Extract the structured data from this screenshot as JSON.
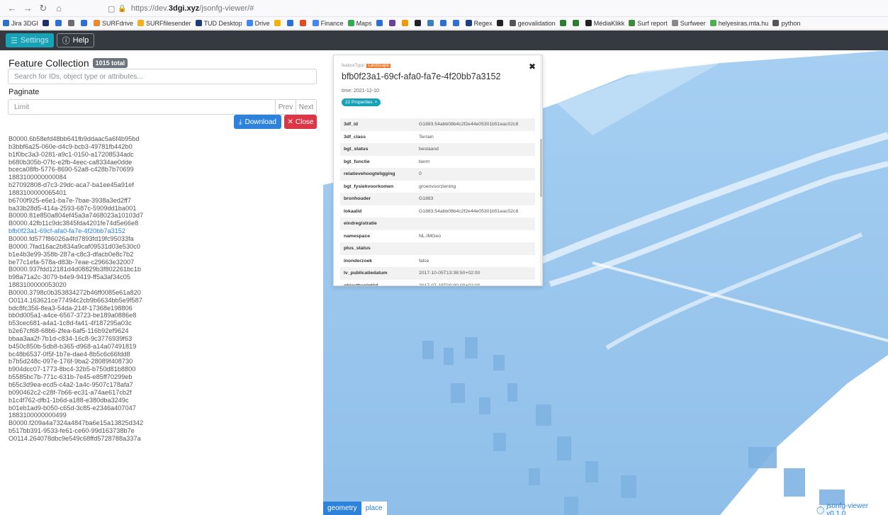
{
  "browser": {
    "url_prefix": "https://dev.",
    "url_domain": "3dgi.xyz",
    "url_path": "/jsonfg-viewer/#",
    "bookmarks": [
      {
        "label": "Jira 3DGI",
        "color": "#2c6fd6"
      },
      {
        "label": "",
        "color": "#1f2f6a"
      },
      {
        "label": "",
        "color": "#2c6fd6"
      },
      {
        "label": "",
        "color": "#6d6d6d"
      },
      {
        "label": "",
        "color": "#2c6fd6"
      },
      {
        "label": "SURFdrive",
        "color": "#f0872b"
      },
      {
        "label": "SURFfilesender",
        "color": "#f2b01e"
      },
      {
        "label": "TUD Desktop",
        "color": "#1c3e78"
      },
      {
        "label": "Drive",
        "color": "#4285f4"
      },
      {
        "label": "",
        "color": "#f5b400"
      },
      {
        "label": "",
        "color": "#2c6fd6"
      },
      {
        "label": "",
        "color": "#e64a19"
      },
      {
        "label": "Finance",
        "color": "#4285f4"
      },
      {
        "label": "Maps",
        "color": "#34a853"
      },
      {
        "label": "",
        "color": "#2c6fd6"
      },
      {
        "label": "",
        "color": "#6b3fa0"
      },
      {
        "label": "",
        "color": "#f29900"
      },
      {
        "label": "",
        "color": "#222222"
      },
      {
        "label": "",
        "color": "#3d7ebf"
      },
      {
        "label": "",
        "color": "#2c6fd6"
      },
      {
        "label": "",
        "color": "#2c6fd6"
      },
      {
        "label": "Regex",
        "color": "#1a3f8a"
      },
      {
        "label": "",
        "color": "#222222"
      },
      {
        "label": "geovalidation",
        "color": "#555555"
      },
      {
        "label": "",
        "color": "#2e7d32"
      },
      {
        "label": "",
        "color": "#2e7d32"
      },
      {
        "label": "MédiaKlikk",
        "color": "#222222"
      },
      {
        "label": "Surf report",
        "color": "#3a8d3a"
      },
      {
        "label": "Surfweer",
        "color": "#888888"
      },
      {
        "label": "helyesiras.mta.hu",
        "color": "#4caf50"
      },
      {
        "label": "python",
        "color": "#555555"
      }
    ]
  },
  "toolbar": {
    "settings_label": "Settings",
    "help_label": "Help"
  },
  "feature_collection": {
    "title": "Feature Collection",
    "total_badge": "1015 total",
    "search_placeholder": "Search for IDs, object type or attributes...",
    "paginate_label": "Paginate",
    "limit_placeholder": "Limit",
    "prev_label": "Prev",
    "next_label": "Next",
    "download_label": "Download",
    "close_label": "Close",
    "selected_id": "bfb0f23a1-69cf-afa0-fa7e-4f20bb7a3152",
    "ids": [
      "B0000.6b58efd48bb641fb9ddaac5a6f4b95bd",
      "b3bbf6a25-060e-d4c9-bcb3-49781fb442b0",
      "b1f0bc3a3-0281-a9c1-0150-a17208534adc",
      "b680b305b-07fc-e2fb-4eec-ca8334ae0dde",
      "bceca08fb-5776-8690-52a8-c428b7b70699",
      "1883100000000084",
      "b27092808-d7c3-29dc-aca7-ba1ee45a91ef",
      "1883100000065401",
      "b6700f925-e6e1-ba7e-7bae-3938a3ed2ff7",
      "ba33b28d5-414a-2593-687c-5909dd1ba001",
      "B0000.81e850a804ef45a3a7468023a10103d7",
      "B0000.42fb11c9dc3845fda4201fe74d5e66e8",
      "bfb0f23a1-69cf-afa0-fa7e-4f20bb7a3152",
      "B0000.fd577f86026a4fd7893fd19fc95033fa",
      "B0000.7fad16ac2b834a9caf09531d03e530c0",
      "b1e4b3e99-358b-287a-c8c3-dfacb0e8c7b2",
      "be77c1efa-578a-d83b-7eae-c29663e32007",
      "B0000.937fdd12181d4d08829b3f802261bc1b",
      "b98a71a2c-3079-b4e9-9419-ff5a3af34c05",
      "1883100000053020",
      "B0000.3798c0b353834272b46ff0085e61a820",
      "O0114.163621ce77494c2cb9b6634bb5e9f587",
      "bdc8fc356-8ea3-54da-214f-17368e198806",
      "bb0d005a1-a4ce-6567-3723-be189a0886e8",
      "b53cec681-a4a1-1c8d-fa41-4f187295a03c",
      "b2e67cf68-68b6-2fea-6af5-116b92ef9624",
      "bbaa3aa2f-7b1d-c834-16c8-9c3776939f63",
      "b450c850b-5db8-b365-d968-a14a07491819",
      "bc48b6537-0f5f-1b7e-dae4-8b5c6c66fdd8",
      "b7b5d248c-097e-176f-9ba2-28089f408730",
      "b904dcc07-1773-8bc4-32b5-b750d81b8800",
      "b5585bc7b-771c-631b-7e45-e85ff70299eb",
      "b65c3d9ea-ecd5-c4a2-1a4c-9507c178afa7",
      "b090462c2-c28f-7b66-ec31-a74ae617cb2f",
      "b1c4f762-dfb1-1b6d-a188-e380dba3249c",
      "b01eb1ad9-b050-c65d-3c85-e2346a407047",
      "1883100000000499",
      "B0000.f209a4a7324a4847ba6e15a13825d342",
      "b517bb391-9533-fe61-ce60-99d163738b7e",
      "O0114.264078dbc9e549c68ffd5728788a337a"
    ]
  },
  "popup": {
    "feature_type_label": "featureType:",
    "feature_type_value": "Landscape",
    "title": "bfb0f23a1-69cf-afa0-fa7e-4f20bb7a3152",
    "time": "time: 2021-12-10",
    "properties_pill": "22 Properties",
    "properties": [
      {
        "key": "3df_id",
        "value": "G1883.54abb08b4c2f2e44e05301b51eac02c8"
      },
      {
        "key": "3df_class",
        "value": "Terrain"
      },
      {
        "key": "bgt_status",
        "value": "bestaand"
      },
      {
        "key": "bgt_functie",
        "value": "berm"
      },
      {
        "key": "relatievehoogteligging",
        "value": "0"
      },
      {
        "key": "bgt_fysiekvoorkomen",
        "value": "groenvoorziening"
      },
      {
        "key": "bronhouder",
        "value": "G1883"
      },
      {
        "key": "lokaalid",
        "value": "G1883.54abb08b4c2f2e44e05301b51eac02c8"
      },
      {
        "key": "eindregistratie",
        "value": ""
      },
      {
        "key": "namespace",
        "value": "NL.IMGeo"
      },
      {
        "key": "plus_status",
        "value": ""
      },
      {
        "key": "inonderzoek",
        "value": "false"
      },
      {
        "key": "lv_publicatiedatum",
        "value": "2017-10-05T13:38:50+02:00"
      },
      {
        "key": "objectbegintijd",
        "value": "2017-07-19T00:00:00+02:00"
      }
    ]
  },
  "map": {
    "tabs": [
      "geometry",
      "place"
    ],
    "active_tab": "geometry",
    "credit": "jsonfg-viewer v0.1.0",
    "terrain_color": "#9cc8ee",
    "accent_color": "#2c83d9"
  }
}
